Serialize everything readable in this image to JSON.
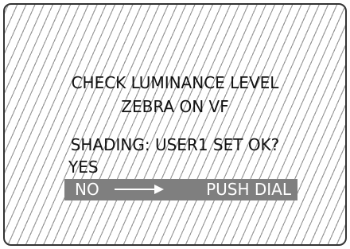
{
  "screen": {
    "line1": "CHECK LUMINANCE LEVEL",
    "line2": "ZEBRA ON VF",
    "line3": "SHADING: USER1 SET OK?"
  },
  "menu": {
    "yes_label": "YES",
    "no_label": "NO",
    "no_hint": "PUSH DIAL",
    "selected": "NO",
    "highlight_color": "#7f7f7f"
  },
  "icons": {
    "arrow": "right-arrow-icon"
  }
}
